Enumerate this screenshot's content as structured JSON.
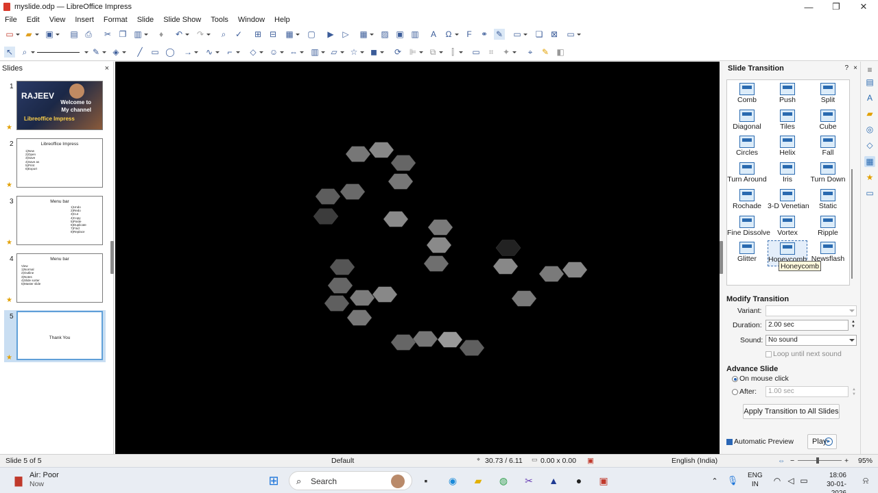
{
  "window": {
    "title": "myslide.odp — LibreOffice Impress",
    "minimize": "—",
    "maximize": "❐",
    "close": "✕"
  },
  "menu": [
    "File",
    "Edit",
    "View",
    "Insert",
    "Format",
    "Slide",
    "Slide Show",
    "Tools",
    "Window",
    "Help"
  ],
  "slides_panel": {
    "title": "Slides",
    "close": "×",
    "slides": [
      {
        "num": "1",
        "texts": [
          "RAJEEV",
          "Welcome to",
          "My channel",
          "Libreoffice Impress"
        ]
      },
      {
        "num": "2",
        "title": "Libreoffice Impress",
        "items": [
          "1)New",
          "2)Open",
          "3)Save",
          "4)Save as",
          "5)Print",
          "6)Export"
        ]
      },
      {
        "num": "3",
        "title": "Menu bar",
        "items": [
          "1)Undo",
          "2)Redo",
          "3)Cut",
          "4)Copy",
          "5)Paste",
          "6)Duplicate",
          "7)Find",
          "8)Replace"
        ]
      },
      {
        "num": "4",
        "title": "Menu bar",
        "items": [
          "View",
          "1)Normal",
          "2)Outline",
          "3)Notes",
          "4)Slide sorter",
          "5)Master slide"
        ]
      },
      {
        "num": "5",
        "title": "Thank You",
        "items": []
      }
    ]
  },
  "sidebar": {
    "title": "Slide Transition",
    "help": "?",
    "close": "×",
    "transitions": [
      "Comb",
      "Push",
      "Split",
      "Diagonal",
      "Tiles",
      "Cube",
      "Circles",
      "Helix",
      "Fall",
      "Turn Around",
      "Iris",
      "Turn Down",
      "Rochade",
      "3-D Venetian",
      "Static",
      "Fine Dissolve",
      "Vortex",
      "Ripple",
      "Glitter",
      "Honeycomb",
      "Newsflash"
    ],
    "selected_transition": "Honeycomb",
    "tooltip": "Honeycomb",
    "modify": {
      "heading": "Modify Transition",
      "variant_label": "Variant:",
      "variant_value": "",
      "duration_label": "Duration:",
      "duration_value": "2.00 sec",
      "sound_label": "Sound:",
      "sound_value": "No sound",
      "loop_label": "Loop until next sound"
    },
    "advance": {
      "heading": "Advance Slide",
      "mouse_label": "On mouse click",
      "after_label": "After:",
      "after_value": "1.00 sec",
      "apply_all": "Apply Transition to All Slides"
    },
    "auto_preview_label": "Automatic Preview",
    "play_label": "Play"
  },
  "statusbar": {
    "slide_info": "Slide 5 of 5",
    "layout": "Default",
    "position": "30.73 / 6.11",
    "size": "0.00 x 0.00",
    "language": "English (India)",
    "zoom": "95%"
  },
  "taskbar": {
    "weather_title": "Air: Poor",
    "weather_sub": "Now",
    "search": "Search",
    "lang_top": "ENG",
    "lang_bottom": "IN",
    "time": "18:06",
    "date": "30-01-2026"
  }
}
